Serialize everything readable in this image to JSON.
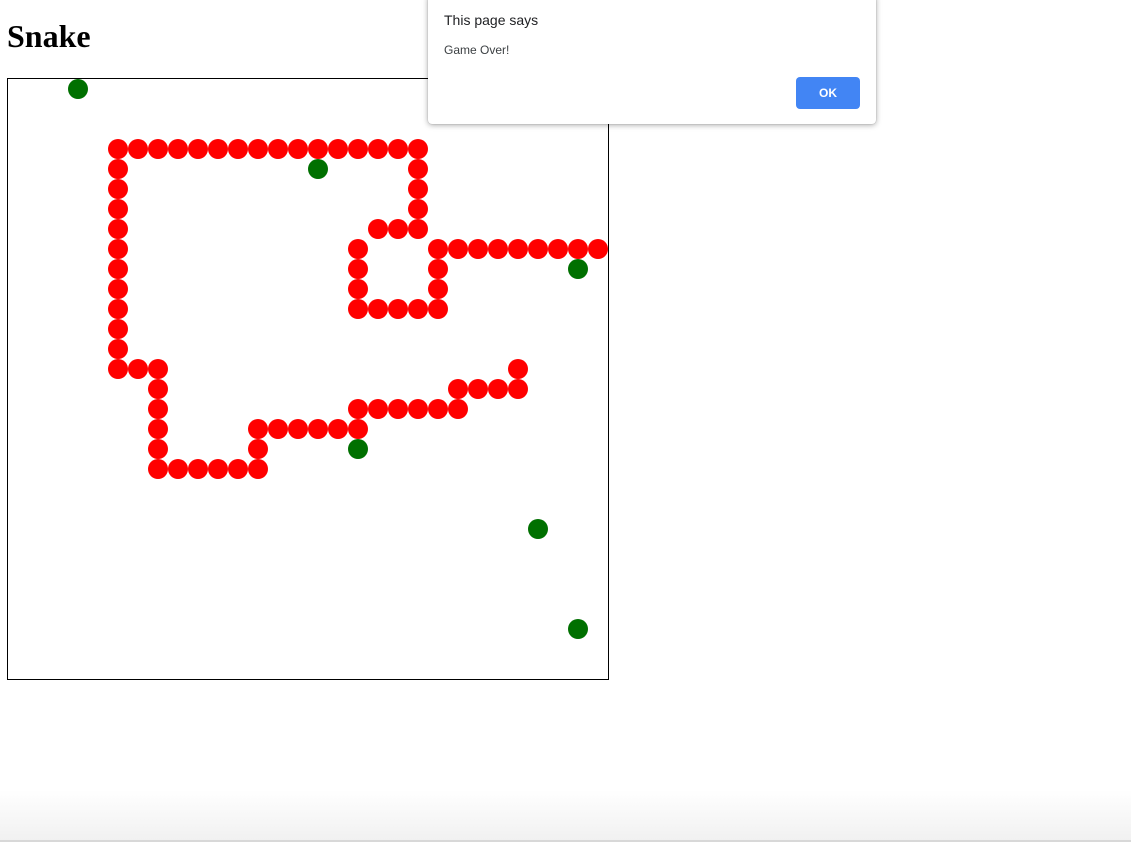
{
  "page": {
    "title": "Snake"
  },
  "game": {
    "grid_cols": 30,
    "grid_rows": 30,
    "snake_color": "#ff0000",
    "food_color": "#007000",
    "snake": [
      [
        5,
        3
      ],
      [
        6,
        3
      ],
      [
        7,
        3
      ],
      [
        8,
        3
      ],
      [
        9,
        3
      ],
      [
        10,
        3
      ],
      [
        11,
        3
      ],
      [
        12,
        3
      ],
      [
        13,
        3
      ],
      [
        14,
        3
      ],
      [
        15,
        3
      ],
      [
        16,
        3
      ],
      [
        17,
        3
      ],
      [
        18,
        3
      ],
      [
        19,
        3
      ],
      [
        20,
        3
      ],
      [
        5,
        4
      ],
      [
        5,
        5
      ],
      [
        5,
        6
      ],
      [
        5,
        7
      ],
      [
        5,
        8
      ],
      [
        5,
        9
      ],
      [
        5,
        10
      ],
      [
        5,
        11
      ],
      [
        5,
        12
      ],
      [
        5,
        13
      ],
      [
        5,
        14
      ],
      [
        6,
        14
      ],
      [
        7,
        14
      ],
      [
        7,
        15
      ],
      [
        7,
        16
      ],
      [
        7,
        17
      ],
      [
        7,
        18
      ],
      [
        7,
        19
      ],
      [
        8,
        19
      ],
      [
        9,
        19
      ],
      [
        10,
        19
      ],
      [
        11,
        19
      ],
      [
        12,
        19
      ],
      [
        12,
        18
      ],
      [
        12,
        17
      ],
      [
        13,
        17
      ],
      [
        14,
        17
      ],
      [
        15,
        17
      ],
      [
        16,
        17
      ],
      [
        17,
        17
      ],
      [
        17,
        16
      ],
      [
        18,
        16
      ],
      [
        19,
        16
      ],
      [
        20,
        16
      ],
      [
        21,
        16
      ],
      [
        22,
        16
      ],
      [
        22,
        15
      ],
      [
        23,
        15
      ],
      [
        24,
        15
      ],
      [
        25,
        15
      ],
      [
        25,
        14
      ],
      [
        20,
        4
      ],
      [
        20,
        5
      ],
      [
        20,
        6
      ],
      [
        20,
        7
      ],
      [
        19,
        7
      ],
      [
        18,
        7
      ],
      [
        17,
        8
      ],
      [
        17,
        9
      ],
      [
        17,
        10
      ],
      [
        17,
        11
      ],
      [
        18,
        11
      ],
      [
        19,
        11
      ],
      [
        20,
        11
      ],
      [
        21,
        11
      ],
      [
        21,
        10
      ],
      [
        21,
        9
      ],
      [
        21,
        8
      ],
      [
        22,
        8
      ],
      [
        23,
        8
      ],
      [
        24,
        8
      ],
      [
        25,
        8
      ],
      [
        26,
        8
      ],
      [
        27,
        8
      ],
      [
        28,
        8
      ],
      [
        29,
        8
      ]
    ],
    "food": [
      [
        3,
        0
      ],
      [
        15,
        4
      ],
      [
        28,
        9
      ],
      [
        17,
        18
      ],
      [
        26,
        22
      ],
      [
        28,
        27
      ]
    ]
  },
  "dialog": {
    "title": "This page says",
    "message": "Game Over!",
    "ok_label": "OK",
    "ok_color": "#4285f4"
  }
}
